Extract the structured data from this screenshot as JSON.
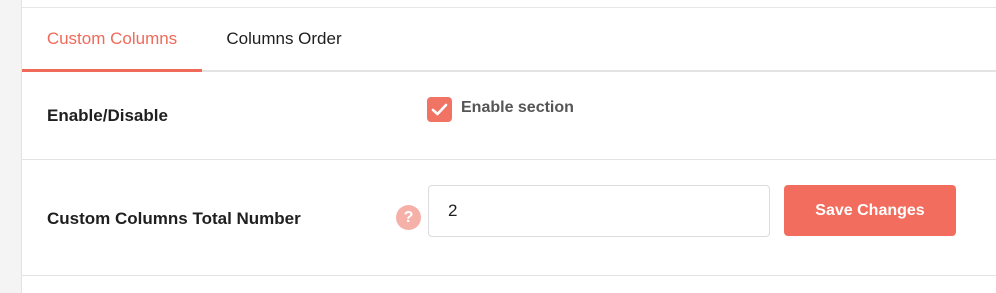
{
  "tabs": [
    {
      "label": "Custom Columns",
      "active": true
    },
    {
      "label": "Columns Order",
      "active": false
    }
  ],
  "rows": {
    "enable": {
      "label": "Enable/Disable",
      "checkbox_label": "Enable section",
      "checked": true
    },
    "total": {
      "label": "Custom Columns Total Number",
      "help_glyph": "?",
      "value": "2"
    }
  },
  "actions": {
    "save_label": "Save Changes"
  },
  "colors": {
    "accent": "#f06a5a",
    "help": "#f5b0a8"
  }
}
